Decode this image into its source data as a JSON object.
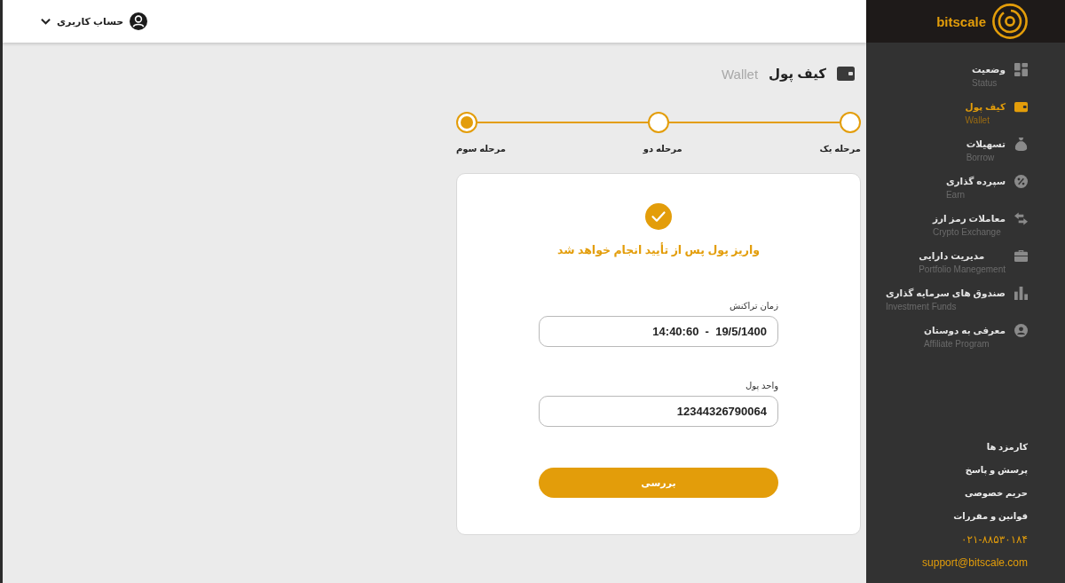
{
  "header": {
    "account_menu": {
      "label": "حساب کاربری"
    }
  },
  "sidebar": {
    "logo": {
      "text": "bitscale"
    },
    "items": [
      {
        "label": "وضعیت",
        "sublabel": "Status",
        "selected": false
      },
      {
        "label": "کیف پول",
        "sublabel": "Wallet",
        "selected": true
      },
      {
        "label": "تسهیلات",
        "sublabel": "Borrow",
        "selected": false
      },
      {
        "label": "سپرده گذاری",
        "sublabel": "Earn",
        "selected": false
      },
      {
        "label": "معاملات رمز ارز",
        "sublabel": "Crypto Exchange",
        "selected": false
      },
      {
        "label": "مدیریت دارایی",
        "sublabel": "Portfolio Manegement",
        "selected": false
      },
      {
        "label": "صندوق های سرمایه گذاری",
        "sublabel": "Investment Funds",
        "selected": false
      },
      {
        "label": "معرفی به دوستان",
        "sublabel": "Affiliate Program",
        "selected": false
      }
    ],
    "footer_links": [
      "کارمزد ها",
      "پرسش و پاسخ",
      "حریم خصوصی",
      "قوانین و مقررات"
    ],
    "contact": {
      "phone": "۰۲۱-۸۸۵۳۰۱۸۴",
      "email": "support@bitscale.com"
    }
  },
  "page": {
    "title": "کیف پول",
    "subtitle": "Wallet"
  },
  "stepper": {
    "steps": [
      {
        "label": "مرحله یک",
        "selected": false
      },
      {
        "label": "مرحله دو",
        "selected": false
      },
      {
        "label": "مرحله سوم",
        "selected": true
      }
    ]
  },
  "card": {
    "message": "واریز پول پس از تأیید انجام خواهد شد",
    "fields": [
      {
        "label": "زمان تراکنش",
        "value": "14:40:60  -  19/5/1400"
      },
      {
        "label": "واحد پول",
        "value": "12344326790064"
      }
    ],
    "button": {
      "label": "بررسی"
    }
  }
}
